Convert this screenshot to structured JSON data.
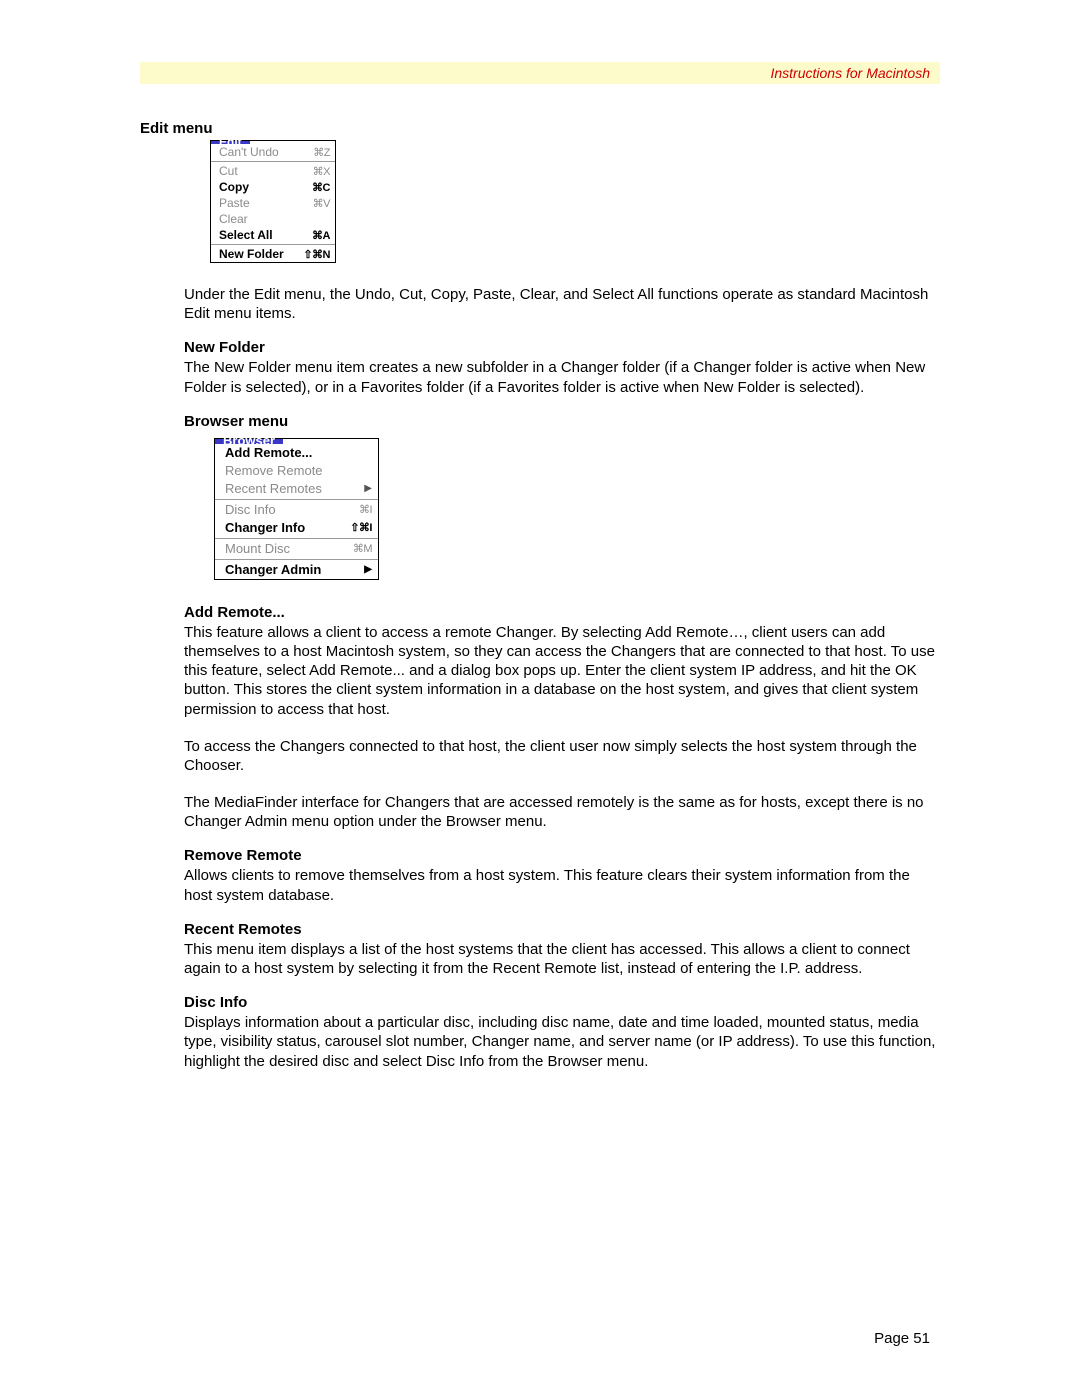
{
  "header": {
    "text": "Instructions for Macintosh"
  },
  "sections": {
    "editMenu": {
      "title": "Edit menu",
      "menu": {
        "title": "Edit",
        "items": [
          {
            "label": "Can't Undo",
            "shortcut": "⌘Z"
          },
          {
            "label": "Cut",
            "shortcut": "⌘X"
          },
          {
            "label": "Copy",
            "shortcut": "⌘C"
          },
          {
            "label": "Paste",
            "shortcut": "⌘V"
          },
          {
            "label": "Clear",
            "shortcut": ""
          },
          {
            "label": "Select All",
            "shortcut": "⌘A"
          },
          {
            "label": "New Folder",
            "shortcut": "⇧⌘N"
          }
        ]
      },
      "para": "Under the Edit menu, the Undo, Cut, Copy, Paste, Clear, and Select All functions operate as standard Macintosh Edit menu items."
    },
    "newFolder": {
      "title": "New Folder",
      "para": "The New Folder menu item creates a new subfolder in a Changer folder (if a Changer folder is active when New Folder is selected), or in a Favorites folder (if a Favorites folder is active when New Folder is selected)."
    },
    "browserMenu": {
      "title": "Browser menu",
      "menu": {
        "title": "Browser",
        "items": [
          {
            "label": "Add Remote...",
            "shortcut": ""
          },
          {
            "label": "Remove Remote",
            "shortcut": ""
          },
          {
            "label": "Recent Remotes",
            "shortcut": "▶"
          },
          {
            "label": "Disc Info",
            "shortcut": "⌘I"
          },
          {
            "label": "Changer Info",
            "shortcut": "⇧⌘I"
          },
          {
            "label": "Mount Disc",
            "shortcut": "⌘M"
          },
          {
            "label": "Changer Admin",
            "shortcut": "▶"
          }
        ]
      }
    },
    "addRemote": {
      "title": "Add Remote...",
      "p1": "This feature allows a client to access a remote Changer. By selecting Add Remote…, client users can add themselves to a host Macintosh system, so they can access the Changers that are connected to that host. To use this feature, select Add Remote... and a dialog box pops up. Enter the client system IP address, and hit the OK button. This stores the client system information in a database on the host system, and gives that client system permission to access that host.",
      "p2": "To access the Changers connected to that host, the client user now simply selects the host system through the Chooser.",
      "p3": "The MediaFinder interface for Changers that are accessed remotely is the same as for hosts, except there is no Changer Admin menu option under the Browser menu."
    },
    "removeRemote": {
      "title": "Remove Remote",
      "para": "Allows clients to remove themselves from a host system. This feature clears their system information from the host system database."
    },
    "recentRemotes": {
      "title": "Recent Remotes",
      "para": "This menu item displays a list of the host systems that the client has accessed. This allows a client to connect again to a host system by selecting it from the Recent Remote list, instead of entering the I.P. address."
    },
    "discInfo": {
      "title": "Disc Info",
      "para": "Displays information about a particular disc, including disc name, date and time loaded, mounted status, media type, visibility status, carousel slot number, Changer name, and server name (or IP address). To use this function, highlight the desired disc and select Disc Info from the Browser menu."
    }
  },
  "pageNumber": "Page 51"
}
